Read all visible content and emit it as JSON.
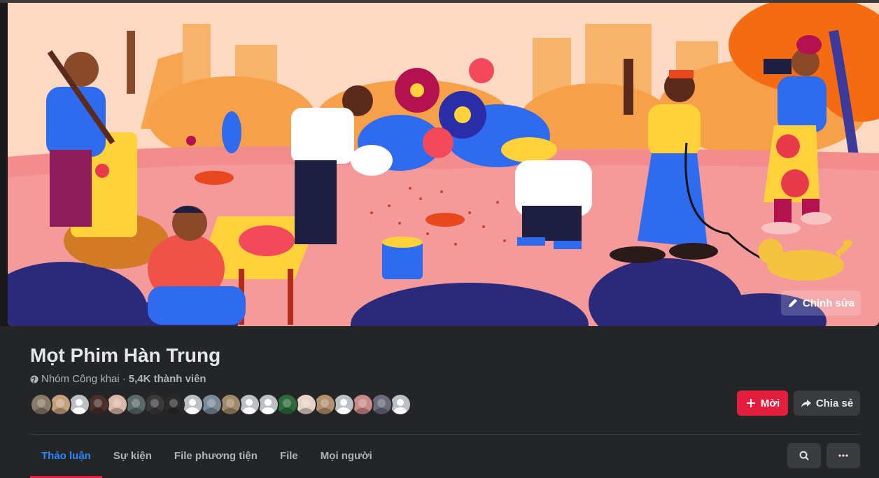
{
  "group": {
    "name": "Mọt Phim Hàn Trung",
    "privacy": "Nhóm Công khai",
    "separator": "·",
    "member_count": "5,4K thành viên"
  },
  "cover": {
    "edit_label": "Chỉnh sửa"
  },
  "actions": {
    "invite_label": "Mời",
    "share_label": "Chia sẻ"
  },
  "tabs": [
    {
      "label": "Thảo luận"
    },
    {
      "label": "Sự kiện"
    },
    {
      "label": "File phương tiện"
    },
    {
      "label": "File"
    },
    {
      "label": "Mọi người"
    }
  ],
  "member_avatars": [
    {
      "color": "#8a7a6a"
    },
    {
      "color": "#c6a27c"
    },
    {
      "color": "default"
    },
    {
      "color": "#4a2f2a"
    },
    {
      "color": "#d9b8a8"
    },
    {
      "color": "#5a6a6a"
    },
    {
      "color": "#3a3a3a"
    },
    {
      "color": "#2a2a2a"
    },
    {
      "color": "default"
    },
    {
      "color": "#7a8a9a"
    },
    {
      "color": "#a08a6a"
    },
    {
      "color": "default"
    },
    {
      "color": "default"
    },
    {
      "color": "#2e6b3a"
    },
    {
      "color": "#e6d2c8"
    },
    {
      "color": "#b59070"
    },
    {
      "color": "default"
    },
    {
      "color": "#c98a8a"
    },
    {
      "color": "#6a6a7a"
    },
    {
      "color": "default"
    }
  ],
  "colors": {
    "accent_red": "#e41e3f",
    "active_tab": "#2d88ff",
    "background": "#18191a",
    "surface": "#242526"
  },
  "icons": [
    "pencil-icon",
    "globe-icon",
    "plus-icon",
    "share-arrow-icon",
    "search-icon",
    "more-dots-icon"
  ]
}
